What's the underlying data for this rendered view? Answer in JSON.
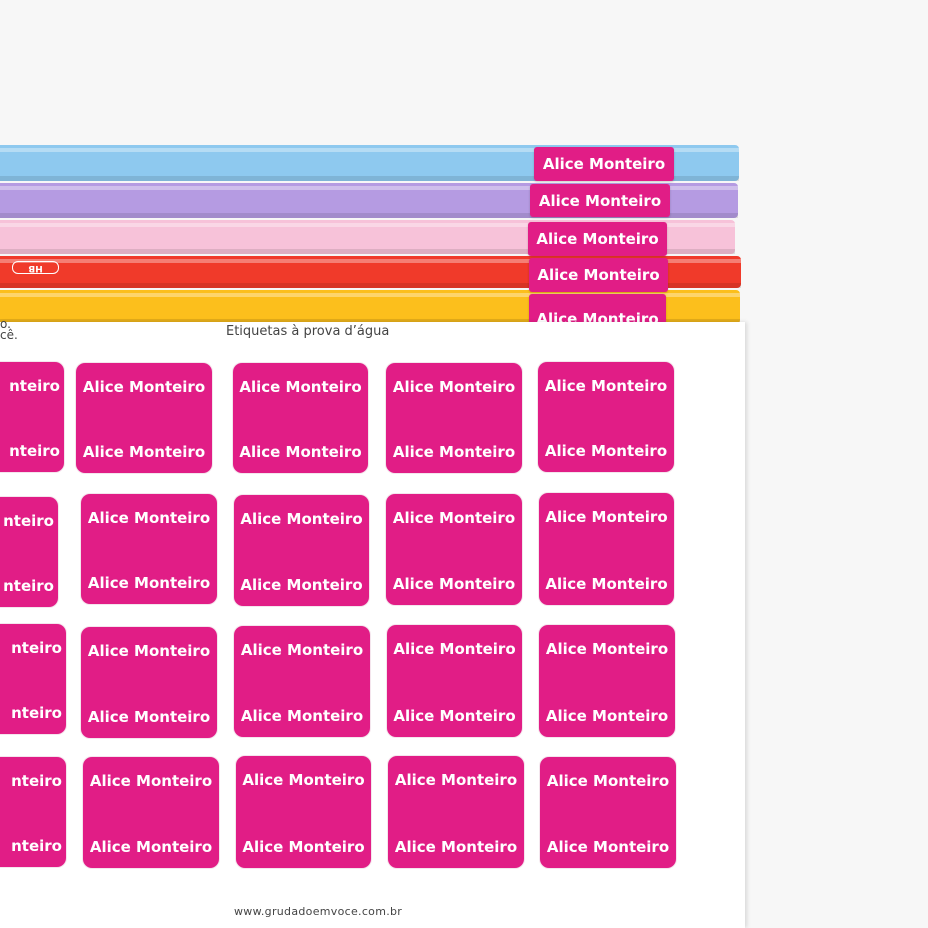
{
  "colors": {
    "label_pink": "#e11d86",
    "pencil_blue": "#8ec9ef",
    "pencil_purple": "#b59be2",
    "pencil_pink": "#f7c2d9",
    "pencil_red": "#f03a2a",
    "pencil_yellow": "#fcbf1c"
  },
  "pencils": [
    {
      "color": "pencil_blue",
      "label": "Alice Monteiro"
    },
    {
      "color": "pencil_purple",
      "label": "Alice Monteiro"
    },
    {
      "color": "pencil_pink",
      "label": "Alice Monteiro"
    },
    {
      "color": "pencil_red",
      "label": "Alice Monteiro",
      "mark": "HB"
    },
    {
      "color": "pencil_yellow",
      "label": "Alice Monteiro"
    }
  ],
  "sheet": {
    "title": "Etiquetas à prova d’água",
    "cut_text_line1": "o.",
    "cut_text_line2": "cê.",
    "footer_url": "www.grudadoemvoce.com.br"
  },
  "sticker_name": "Alice Monteiro",
  "sticker_name_cut": "nteiro"
}
